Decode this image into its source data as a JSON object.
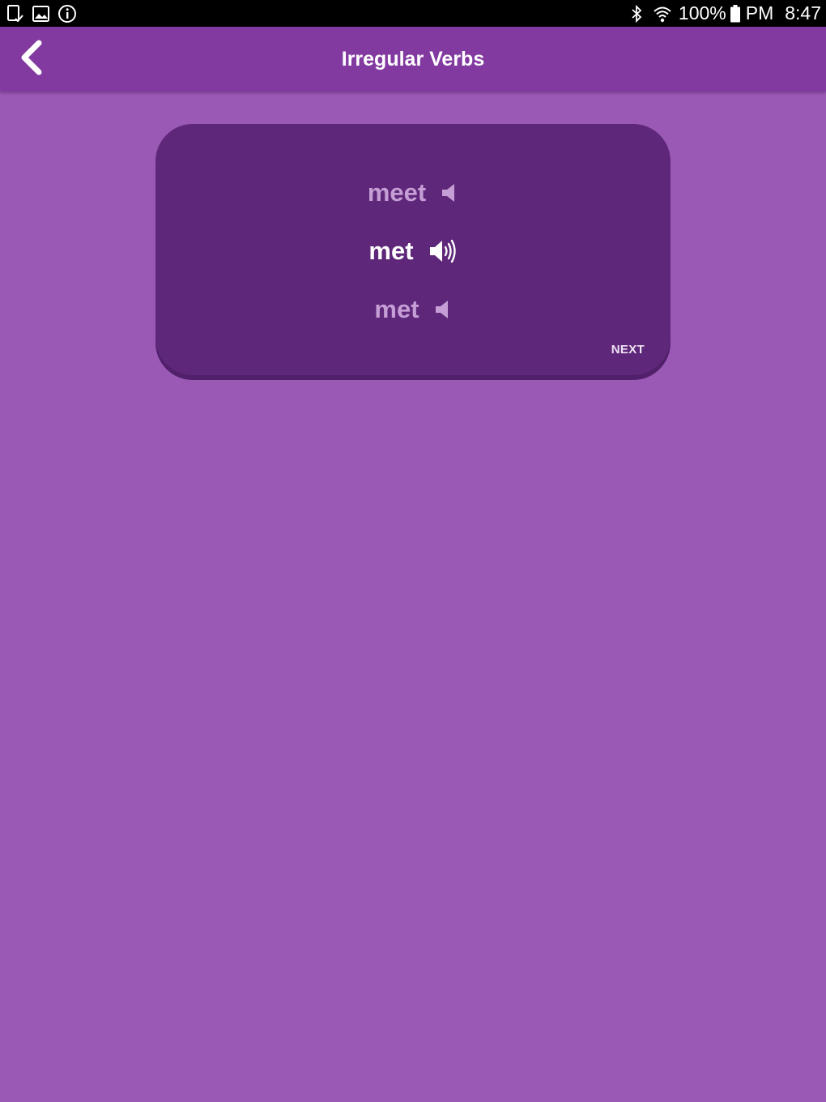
{
  "status_bar": {
    "left_icons": [
      "tablet-check-icon",
      "image-icon",
      "info-icon"
    ],
    "right_icons": [
      "bluetooth-icon",
      "wifi-icon",
      "battery-icon"
    ],
    "battery": "100%",
    "ampm": "PM",
    "time": "8:47"
  },
  "header": {
    "title": "Irregular Verbs",
    "back_icon": "chevron-left-icon"
  },
  "card": {
    "forms": [
      {
        "word": "meet",
        "icon": "speaker-icon",
        "active": false
      },
      {
        "word": "met",
        "icon": "speaker-sound-icon",
        "active": true
      },
      {
        "word": "met",
        "icon": "speaker-icon",
        "active": false
      }
    ],
    "next_label": "NEXT"
  },
  "colors": {
    "background": "#9a59b5",
    "app_bar": "#8239a0",
    "card": "#5e2779",
    "text_active": "#ffffff",
    "text_dim": "#c59ed6"
  }
}
